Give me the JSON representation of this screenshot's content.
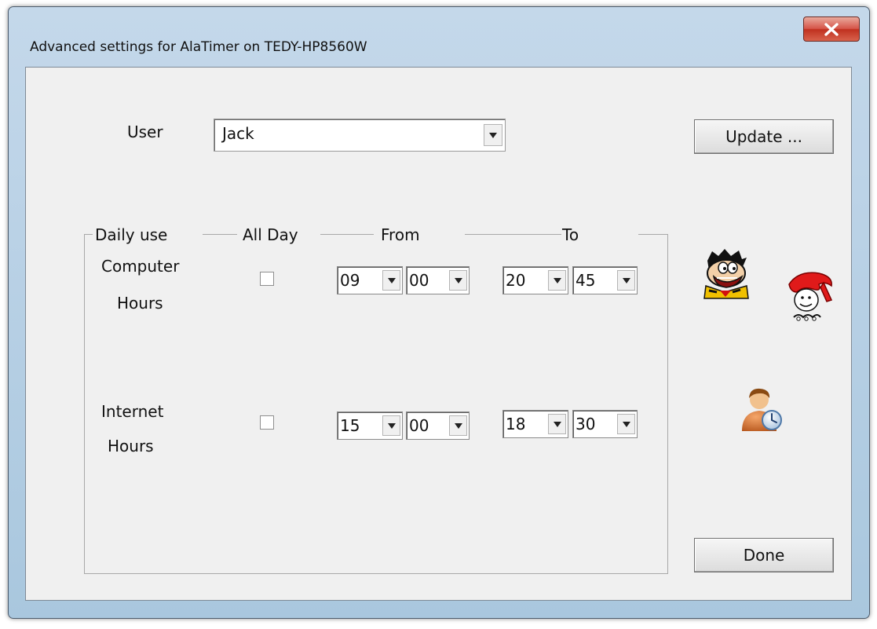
{
  "window": {
    "title": "Advanced settings for AlaTimer on TEDY-HP8560W"
  },
  "user": {
    "label": "User",
    "value": "Jack"
  },
  "buttons": {
    "update": "Update ...",
    "done": "Done"
  },
  "group": {
    "daily_use": "Daily use",
    "all_day": "All Day",
    "from": "From",
    "to": "To"
  },
  "computer": {
    "label_line1": "Computer",
    "label_line2": "Hours",
    "all_day_checked": false,
    "from_hour": "09",
    "from_min": "00",
    "to_hour": "20",
    "to_min": "45"
  },
  "internet": {
    "label_line1": "Internet",
    "label_line2": "Hours",
    "all_day_checked": false,
    "from_hour": "15",
    "from_min": "00",
    "to_hour": "18",
    "to_min": "30"
  },
  "icons": [
    "close-icon",
    "fred-flintstone-icon",
    "wilma-flintstone-icon",
    "user-clock-icon",
    "dropdown-arrow-icon"
  ]
}
